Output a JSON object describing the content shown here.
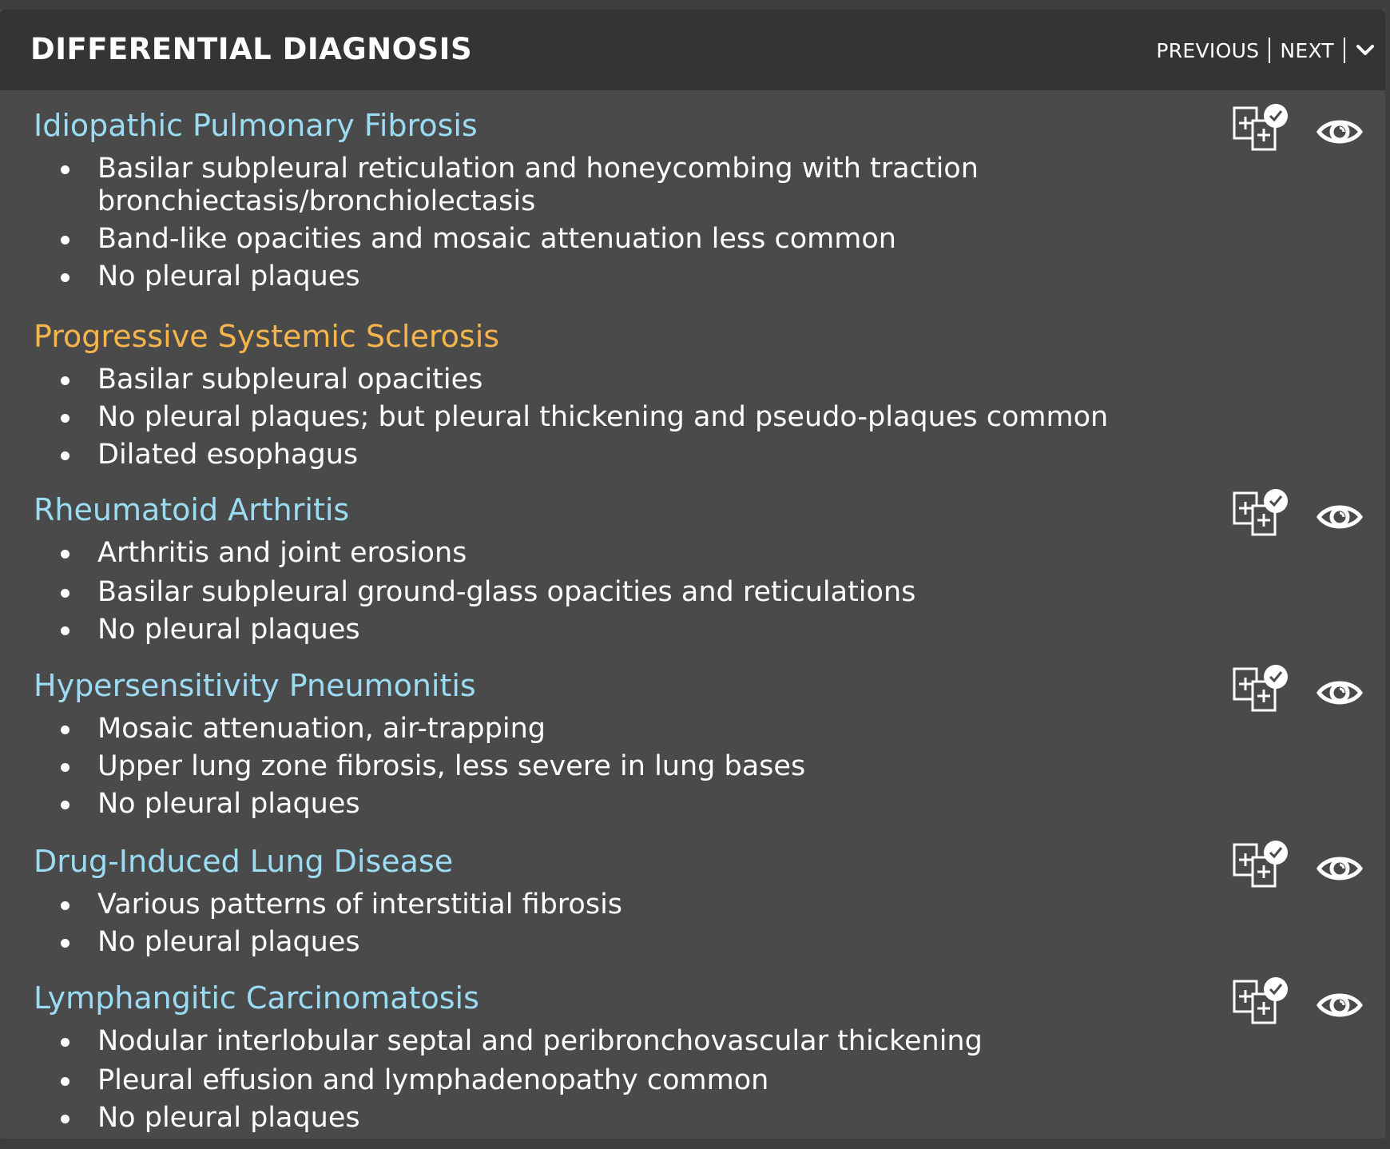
{
  "header": {
    "title": "DIFFERENTIAL DIAGNOSIS",
    "previous_label": "PREVIOUS",
    "next_label": "NEXT"
  },
  "colors": {
    "link_blue": "#9bdcf3",
    "active_orange": "#f5b54c",
    "panel_bg": "#4a4a4a",
    "header_bg": "#343434"
  },
  "diagnoses": [
    {
      "title": "Idiopathic Pulmonary Fibrosis",
      "bullets": [
        "Basilar subpleural reticulation and honeycombing with traction",
        "bronchiectasis/bronchiolectasis",
        "Band-like opacities and mosaic attenuation less common",
        "No pleural plaques"
      ],
      "icons": [
        "compare-images-icon",
        "eye-icon"
      ]
    },
    {
      "title": "Progressive Systemic Sclerosis",
      "bullets": [
        "Basilar subpleural opacities",
        "No pleural plaques; but pleural thickening and pseudo-plaques common",
        "Dilated esophagus"
      ],
      "icons": []
    },
    {
      "title": "Rheumatoid Arthritis",
      "bullets": [
        "Arthritis and joint erosions",
        "Basilar subpleural ground-glass opacities and reticulations",
        "No pleural plaques"
      ],
      "icons": [
        "compare-images-icon",
        "eye-icon"
      ]
    },
    {
      "title": "Hypersensitivity Pneumonitis",
      "bullets": [
        "Mosaic attenuation, air-trapping",
        "Upper lung zone fibrosis, less severe in lung bases",
        "No pleural plaques"
      ],
      "icons": [
        "compare-images-icon",
        "eye-icon"
      ]
    },
    {
      "title": "Drug-Induced Lung Disease",
      "bullets": [
        "Various patterns of interstitial fibrosis",
        "No pleural plaques"
      ],
      "icons": [
        "compare-images-icon",
        "eye-icon"
      ]
    },
    {
      "title": "Lymphangitic Carcinomatosis",
      "bullets": [
        "Nodular interlobular septal and peribronchovascular thickening",
        "Pleural effusion and lymphadenopathy common",
        "No pleural plaques"
      ],
      "icons": [
        "compare-images-icon",
        "eye-icon"
      ]
    }
  ]
}
